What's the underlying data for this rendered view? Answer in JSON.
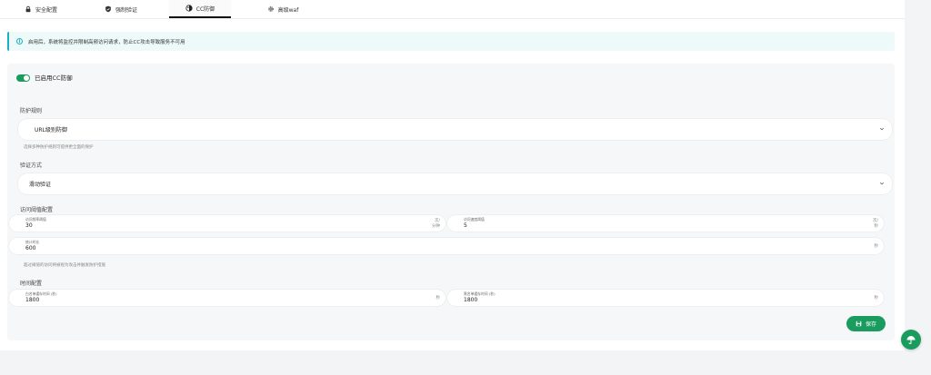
{
  "tabs": [
    {
      "label": "安全配置",
      "icon": "lock-icon"
    },
    {
      "label": "强制验证",
      "icon": "shield-icon"
    },
    {
      "label": "CC防御",
      "icon": "shield-half-icon",
      "active": true
    },
    {
      "label": "高级waf",
      "icon": "gear-icon"
    }
  ],
  "notice": {
    "text": "启用后，系统将监控并限制高频访问请求，防止CC攻击导致服务不可用"
  },
  "toggle": {
    "label": "已启用CC防御",
    "enabled": true
  },
  "protection": {
    "label": "防护规则",
    "selected": "URL级别防御",
    "hint": "选择多种防护规则可提供更全面的保护"
  },
  "verify": {
    "label": "验证方式",
    "selected": "滑动验证"
  },
  "threshold": {
    "title": "访问阈值配置",
    "freq": {
      "label": "访问频率阈值",
      "value": "30",
      "unit": "次/分钟"
    },
    "speed": {
      "label": "访问速度阈值",
      "value": "5",
      "unit": "次/秒"
    },
    "window": {
      "label": "统计时长",
      "value": "600",
      "unit": "秒"
    },
    "hint": "超过阈值的访问将被视为攻击并触发防护措施"
  },
  "timing": {
    "title": "时间配置",
    "white": {
      "label": "白名单缓存时间 (秒)",
      "value": "1800",
      "unit": "秒"
    },
    "black": {
      "label": "黑名单缓存时间 (秒)",
      "value": "1800",
      "unit": "秒"
    }
  },
  "save": {
    "label": "保存"
  },
  "colors": {
    "accent": "#1a9c5f",
    "info": "#17b3c4"
  }
}
